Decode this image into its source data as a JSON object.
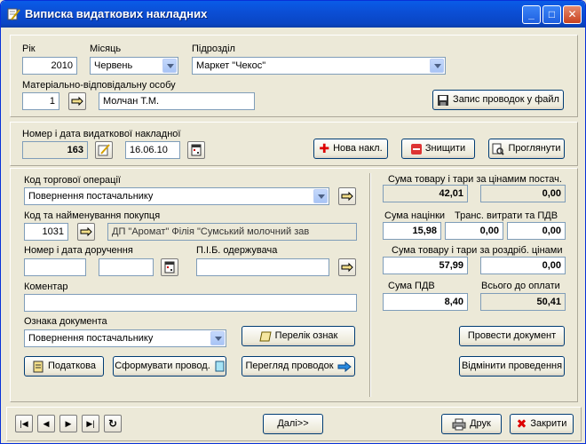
{
  "window": {
    "title": "Виписка видаткових накладних"
  },
  "top": {
    "year_label": "Рік",
    "year_value": "2010",
    "month_label": "Місяць",
    "month_value": "Червень",
    "division_label": "Підрозділ",
    "division_value": "Маркет \"Чекос\"",
    "responsible_label": "Матеріально-відповідальну особу",
    "responsible_id": "1",
    "responsible_name": "Молчан Т.М.",
    "export_button": "Запис проводок у файл"
  },
  "invoice": {
    "label": "Номер і дата видаткової накладної",
    "number": "163",
    "date": "16.06.10",
    "new_button": "Нова накл.",
    "delete_button": "Знищити",
    "view_button": "Проглянути"
  },
  "details": {
    "operation_label": "Код торгової операції",
    "operation_value": "Повернення постачальнику",
    "buyer_label": "Код та найменування покупця",
    "buyer_code": "1031",
    "buyer_name": "ДП \"Аромат\" Філія \"Сумський молочний зав",
    "proxy_label": "Номер і дата доручення",
    "recipient_label": "П.І.Б. одержувача",
    "comment_label": "Коментар",
    "doc_mark_label": "Ознака документа",
    "doc_mark_value": "Повернення постачальнику",
    "marks_list_button": "Перелік ознак",
    "tax_button": "Податкова",
    "form_postings_button": "Сформувати провод.",
    "view_postings_button": "Перегляд проводок"
  },
  "sums": {
    "supplier_label": "Сума товару і тари за цінамим постач.",
    "supplier_value": "42,01",
    "supplier_value2": "0,00",
    "markup_label": "Сума націнки",
    "markup_value": "15,98",
    "transport_label": "Транс. витрати та ПДВ",
    "transport_value1": "0,00",
    "transport_value2": "0,00",
    "retail_label": "Сума товару і тари за роздріб. цінами",
    "retail_value": "57,99",
    "retail_value2": "0,00",
    "vat_label": "Сума ПДВ",
    "vat_value": "8,40",
    "total_label": "Всього до оплати",
    "total_value": "50,41",
    "post_button": "Провести документ",
    "cancel_button": "Відмінити проведення"
  },
  "footer": {
    "next_button": "Далі>>",
    "print_button": "Друк",
    "close_button": "Закрити"
  },
  "colors": {
    "title_bar": "#0b4fd6",
    "window_bg": "#ece9d8",
    "field_border": "#7f9db9"
  }
}
